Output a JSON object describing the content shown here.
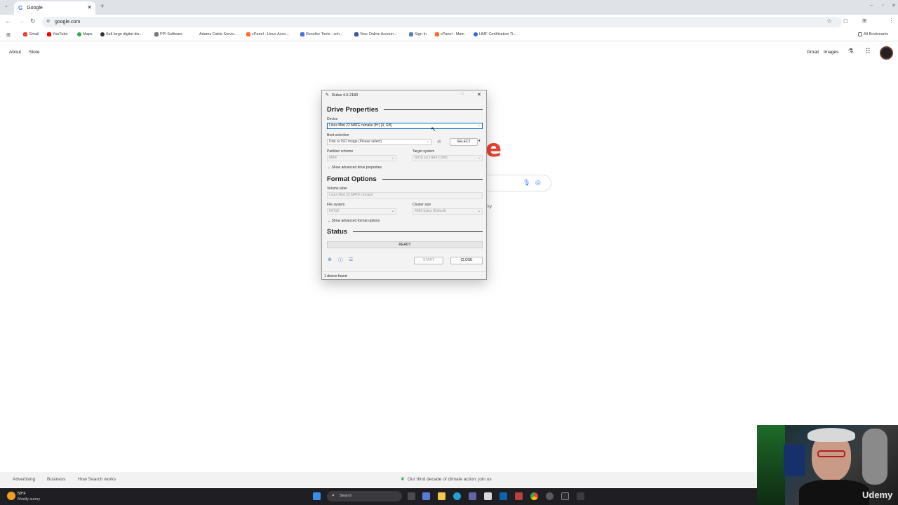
{
  "browser": {
    "tab_title": "Google",
    "url": "google.com",
    "bookmarks": [
      "Gmail",
      "YouTube",
      "Maps",
      "Sell large digital dis...",
      "PPI Software",
      "Adams Cable Servic...",
      "cPanel - Linux Acco...",
      "Reseller Tools - sch...",
      "Your Online Accoun...",
      "Sign In",
      "cPanel - Main",
      "HMF Certification Ti..."
    ],
    "all_bookmarks": "All Bookmarks"
  },
  "google": {
    "about": "About",
    "store": "Store",
    "gmail": "Gmail",
    "images": "Images",
    "logo_fragment": "e",
    "side_text": "ky",
    "footer_left": [
      "Advertising",
      "Business",
      "How Search works"
    ],
    "footer_center": "Our third decade of climate action: join us"
  },
  "rufus": {
    "title": "Rufus 4.5.2180",
    "drive_properties": "Drive Properties",
    "device_label": "Device",
    "device_value": "Linux Mint 22 MATE remake (H:) [4, GB]",
    "boot_selection_label": "Boot selection",
    "boot_selection_value": "Disk or ISO image (Please select)",
    "select_button": "SELECT",
    "partition_scheme_label": "Partition scheme",
    "partition_scheme_value": "MBR",
    "target_system_label": "Target system",
    "target_system_value": "BIOS (or UEFI-CSM)",
    "show_advanced_drive": "Show advanced drive properties",
    "format_options": "Format Options",
    "volume_label_label": "Volume label",
    "volume_label_value": "Linux Mint 22 MATE remake",
    "file_system_label": "File system",
    "file_system_value": "FAT32",
    "cluster_size_label": "Cluster size",
    "cluster_size_value": "4096 bytes (Default)",
    "show_advanced_format": "Show advanced format options",
    "status": "Status",
    "status_value": "READY",
    "start_button": "START",
    "close_button": "CLOSE",
    "footer_text": "1 device found"
  },
  "taskbar": {
    "weather_temp": "59°F",
    "weather_desc": "Mostly sunny",
    "search_placeholder": "Search"
  },
  "webcam": {
    "watermark": "Udemy"
  }
}
